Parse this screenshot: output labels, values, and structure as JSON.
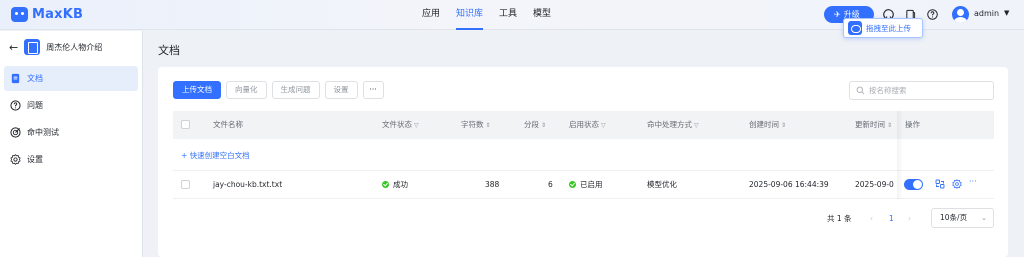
{
  "app": {
    "name": "MaxKB"
  },
  "nav": {
    "items": [
      "应用",
      "知识库",
      "工具",
      "模型"
    ],
    "active": "知识库"
  },
  "header": {
    "upgrade_label": "升级",
    "username": "admin"
  },
  "floating_widget": {
    "label": "拖拽至此上传"
  },
  "sidebar": {
    "knowledge_name": "周杰伦人物介绍",
    "items": [
      {
        "label": "文档",
        "icon": "document-icon",
        "active": true
      },
      {
        "label": "问题",
        "icon": "question-circle-icon",
        "active": false
      },
      {
        "label": "命中测试",
        "icon": "target-icon",
        "active": false
      },
      {
        "label": "设置",
        "icon": "gear-icon",
        "active": false
      }
    ]
  },
  "page": {
    "title": "文档"
  },
  "toolbar": {
    "upload": "上传文档",
    "vectorize": "向量化",
    "generate_questions": "生成问题",
    "settings": "设置",
    "more": "···"
  },
  "search": {
    "placeholder": "按名称搜索",
    "value": ""
  },
  "table": {
    "columns": {
      "name": "文件名称",
      "status": "文件状态",
      "chars": "字符数",
      "segments": "分段",
      "enable_status": "启用状态",
      "hit_handling": "命中处理方式",
      "created": "创建时间",
      "updated": "更新时间",
      "actions": "操作"
    },
    "quick_create": "+ 快速创建空白文档",
    "rows": [
      {
        "name": "jay-chou-kb.txt.txt",
        "status": "成功",
        "chars": "388",
        "segments": "6",
        "enable_status": "已启用",
        "hit_handling": "模型优化",
        "created": "2025-09-06 16:44:39",
        "updated": "2025-09-0",
        "enabled": true
      }
    ]
  },
  "pagination": {
    "total": "共 1 条",
    "current_page": "1",
    "page_size": "10条/页"
  },
  "colors": {
    "primary": "#3370ff",
    "success": "#34c724",
    "text": "#1f2329",
    "muted": "#646a73"
  }
}
